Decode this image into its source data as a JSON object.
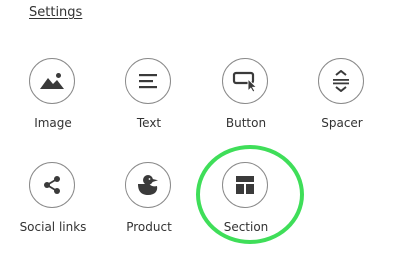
{
  "settings": {
    "label": "Settings"
  },
  "tiles": [
    {
      "label": "Image",
      "icon": "image-icon"
    },
    {
      "label": "Text",
      "icon": "text-icon"
    },
    {
      "label": "Button",
      "icon": "button-cursor-icon"
    },
    {
      "label": "Spacer",
      "icon": "spacer-icon"
    },
    {
      "label": "Social links",
      "icon": "share-icon"
    },
    {
      "label": "Product",
      "icon": "duck-icon"
    },
    {
      "label": "Section",
      "icon": "section-layout-icon"
    }
  ],
  "highlight": {
    "target": "Section",
    "color": "#3fde59"
  }
}
